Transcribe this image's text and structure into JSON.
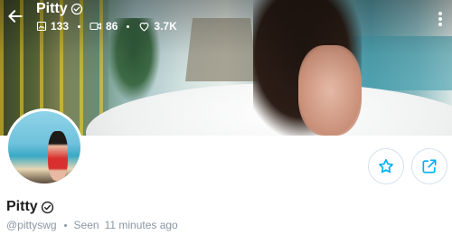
{
  "header": {
    "title": "Pitty",
    "stats": {
      "photos": "133",
      "videos": "86",
      "likes": "3.7K"
    }
  },
  "profile": {
    "name": "Pitty",
    "handle": "@pittyswg",
    "last_seen_label": "Seen",
    "last_seen_time": "11 minutes ago"
  },
  "colors": {
    "accent": "#00aff0",
    "muted_text": "#8a96a3",
    "name_text": "#1d1d1f"
  },
  "icons": {
    "back": "back-arrow-icon",
    "verified": "verified-badge-icon",
    "photos": "image-icon",
    "videos": "video-icon",
    "likes": "heart-icon",
    "more": "more-vertical-icon",
    "favorite": "star-icon",
    "share": "share-icon"
  }
}
